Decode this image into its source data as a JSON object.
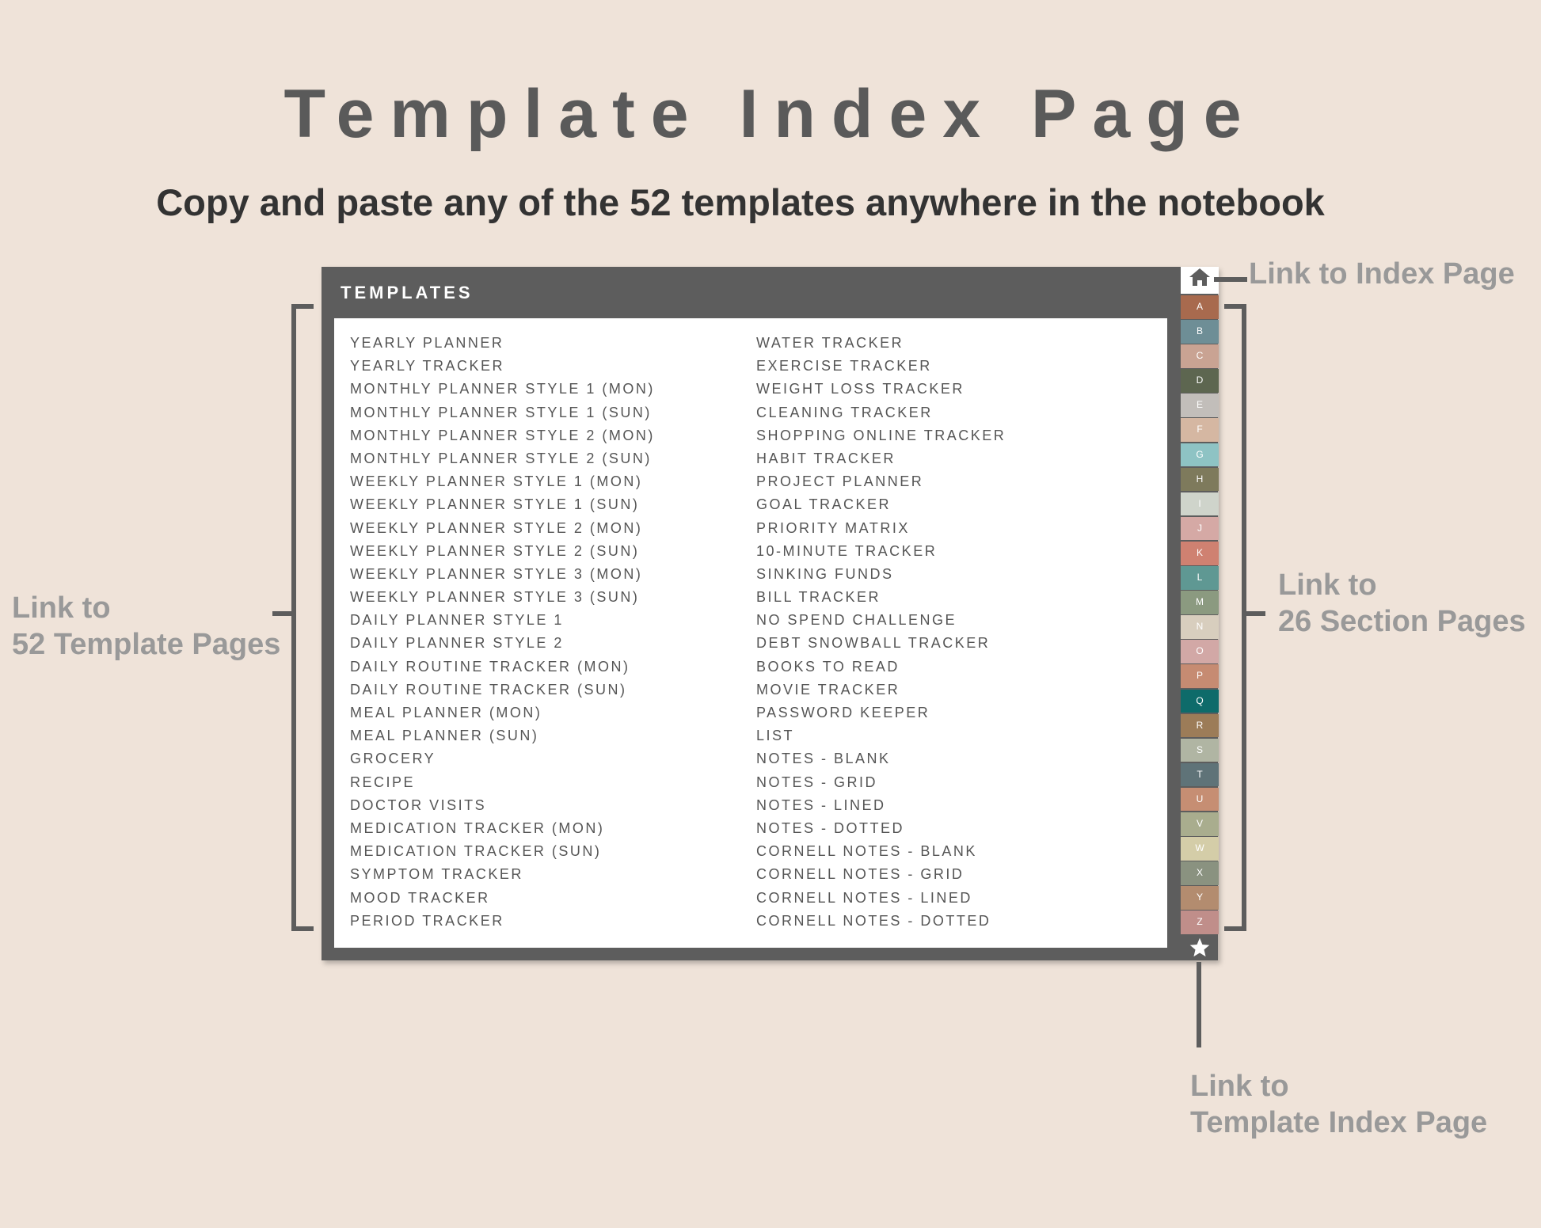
{
  "title": "Template Index Page",
  "subtitle": "Copy and paste any of the 52 templates anywhere in the notebook",
  "notebook": {
    "header": "TEMPLATES",
    "left_column": [
      "YEARLY PLANNER",
      "YEARLY TRACKER",
      "MONTHLY PLANNER STYLE 1 (MON)",
      "MONTHLY PLANNER STYLE 1 (SUN)",
      "MONTHLY PLANNER STYLE 2 (MON)",
      "MONTHLY PLANNER STYLE 2 (SUN)",
      "WEEKLY PLANNER STYLE 1 (MON)",
      "WEEKLY PLANNER STYLE 1 (SUN)",
      "WEEKLY PLANNER STYLE 2 (MON)",
      "WEEKLY PLANNER STYLE 2 (SUN)",
      "WEEKLY PLANNER STYLE 3 (MON)",
      "WEEKLY PLANNER STYLE 3 (SUN)",
      "DAILY PLANNER STYLE 1",
      "DAILY PLANNER STYLE 2",
      "DAILY ROUTINE TRACKER (MON)",
      "DAILY ROUTINE TRACKER (SUN)",
      "MEAL PLANNER (MON)",
      "MEAL PLANNER (SUN)",
      "GROCERY",
      "RECIPE",
      "DOCTOR VISITS",
      "MEDICATION TRACKER (MON)",
      "MEDICATION TRACKER (SUN)",
      "SYMPTOM TRACKER",
      "MOOD TRACKER",
      "PERIOD TRACKER"
    ],
    "right_column": [
      "WATER TRACKER",
      "EXERCISE TRACKER",
      "WEIGHT LOSS TRACKER",
      "CLEANING TRACKER",
      "SHOPPING ONLINE TRACKER",
      "HABIT TRACKER",
      "PROJECT PLANNER",
      "GOAL TRACKER",
      "PRIORITY MATRIX",
      "10-MINUTE TRACKER",
      "SINKING FUNDS",
      "BILL TRACKER",
      "NO SPEND CHALLENGE",
      "DEBT SNOWBALL TRACKER",
      "BOOKS TO READ",
      "MOVIE TRACKER",
      "PASSWORD KEEPER",
      "LIST",
      "NOTES - BLANK",
      "NOTES - GRID",
      "NOTES - LINED",
      "NOTES - DOTTED",
      "CORNELL NOTES - BLANK",
      "CORNELL NOTES - GRID",
      "CORNELL NOTES - LINED",
      "CORNELL NOTES - DOTTED"
    ],
    "tabs": [
      {
        "label": "A",
        "color": "#A86A4E"
      },
      {
        "label": "B",
        "color": "#6E8E96"
      },
      {
        "label": "C",
        "color": "#C9A393"
      },
      {
        "label": "D",
        "color": "#5D6650"
      },
      {
        "label": "E",
        "color": "#C2BEBA"
      },
      {
        "label": "F",
        "color": "#D5B7A2"
      },
      {
        "label": "G",
        "color": "#8EC3C4"
      },
      {
        "label": "H",
        "color": "#7E7A5C"
      },
      {
        "label": "I",
        "color": "#CFD4CB"
      },
      {
        "label": "J",
        "color": "#D5A9A5"
      },
      {
        "label": "K",
        "color": "#CF8171"
      },
      {
        "label": "L",
        "color": "#5F9893"
      },
      {
        "label": "M",
        "color": "#8B9A80"
      },
      {
        "label": "N",
        "color": "#D8CEBE"
      },
      {
        "label": "O",
        "color": "#D2A8A6"
      },
      {
        "label": "P",
        "color": "#C68B72"
      },
      {
        "label": "Q",
        "color": "#0E6B6A"
      },
      {
        "label": "R",
        "color": "#9C7C58"
      },
      {
        "label": "S",
        "color": "#B0B5A3"
      },
      {
        "label": "T",
        "color": "#5F7378"
      },
      {
        "label": "U",
        "color": "#C68E73"
      },
      {
        "label": "V",
        "color": "#A9AD8E"
      },
      {
        "label": "W",
        "color": "#D4CDA8"
      },
      {
        "label": "X",
        "color": "#8A9280"
      },
      {
        "label": "Y",
        "color": "#B38C6F"
      },
      {
        "label": "Z",
        "color": "#C08E8A"
      }
    ]
  },
  "callouts": {
    "index_page": "Link to Index Page",
    "template_pages_line1": "Link to",
    "template_pages_line2": "52 Template Pages",
    "section_pages_line1": "Link to",
    "section_pages_line2": "26 Section Pages",
    "template_index_line1": "Link to",
    "template_index_line2": "Template Index Page"
  },
  "icons": {
    "home": "home-icon",
    "star": "star-icon"
  }
}
